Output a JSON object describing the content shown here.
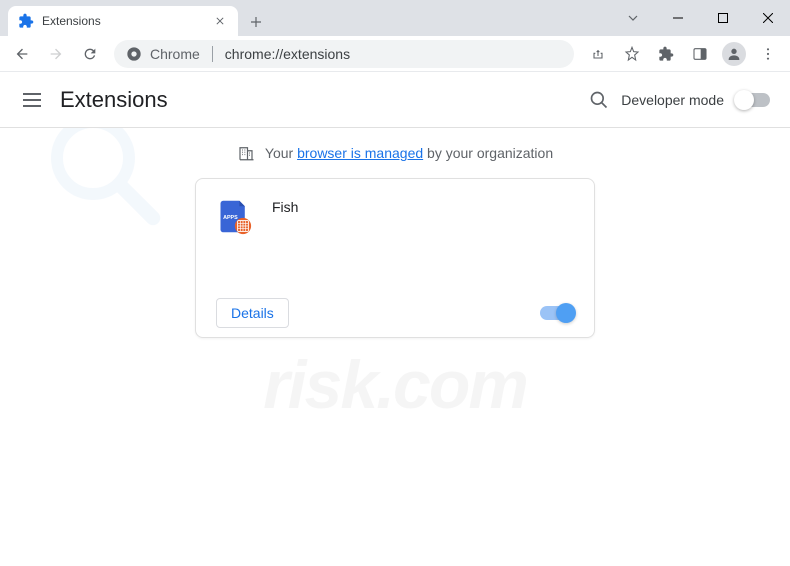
{
  "tab": {
    "title": "Extensions"
  },
  "omnibox": {
    "prefix": "Chrome",
    "url": "chrome://extensions"
  },
  "page": {
    "title": "Extensions",
    "devmode_label": "Developer mode"
  },
  "managed": {
    "prefix": "Your",
    "link": "browser is managed",
    "suffix": "by your organization"
  },
  "extension": {
    "name": "Fish",
    "details_label": "Details",
    "icon_text": "APPS",
    "enabled": true
  }
}
